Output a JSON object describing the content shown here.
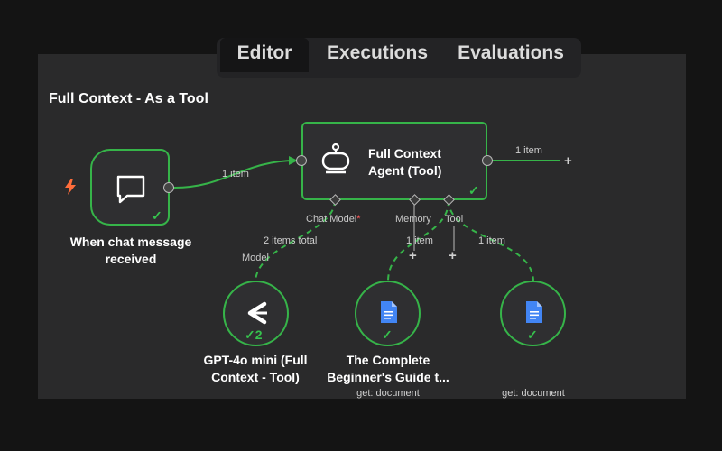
{
  "tabs": [
    {
      "label": "Editor",
      "active": true
    },
    {
      "label": "Executions",
      "active": false
    },
    {
      "label": "Evaluations",
      "active": false
    }
  ],
  "workflow_title": "Full Context - As a Tool",
  "nodes": {
    "trigger": {
      "title": "When chat message received",
      "line1": "When chat message",
      "line2": "received",
      "icon": "chat-bubble-icon",
      "status": "success"
    },
    "agent": {
      "line1": "Full Context",
      "line2": "Agent (Tool)",
      "icon": "robot-icon",
      "status": "success"
    },
    "model": {
      "line1": "GPT-4o mini (Full",
      "line2": "Context - Tool)",
      "icon": "openai-icon",
      "run_count": "2"
    },
    "doc1": {
      "line1": "The Complete",
      "line2": "Beginner's Guide t...",
      "subtitle": "get: document",
      "icon": "google-docs-icon"
    },
    "doc2": {
      "subtitle": "get: document",
      "icon": "google-docs-icon"
    }
  },
  "handles": {
    "chat_model": "Chat Model",
    "chat_model_required": "*",
    "memory": "Memory",
    "tool": "Tool",
    "model": "Model"
  },
  "edges": {
    "trigger_to_agent": "1 item",
    "agent_output": "1 item",
    "model_link": "2 items total",
    "tool_doc1": "1 item",
    "tool_doc2": "1 item"
  },
  "colors": {
    "success": "#36b449",
    "canvas": "#2a2a2b",
    "node_bg": "#2f2f31",
    "trigger_bolt": "#ff6d3b",
    "required_star": "#ff5a5a",
    "docs_blue": "#4285f4"
  }
}
